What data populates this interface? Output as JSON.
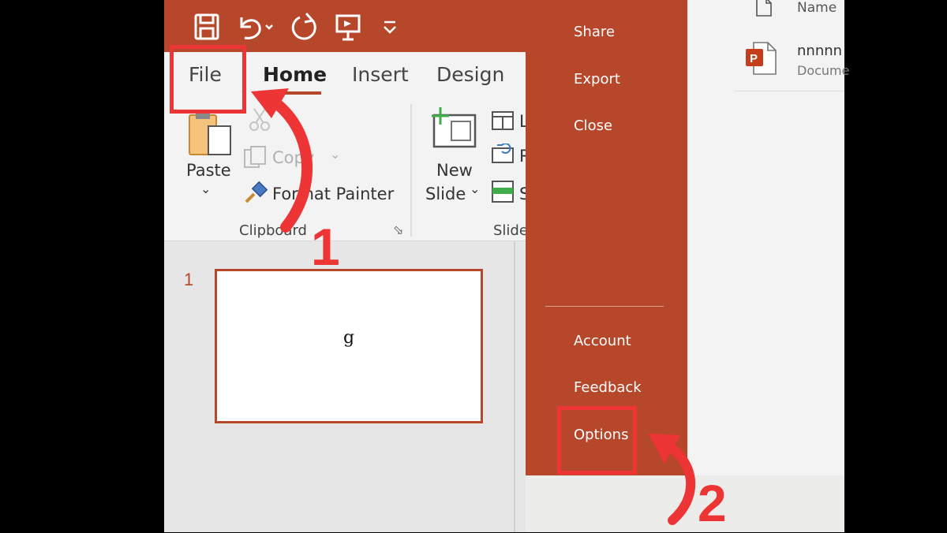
{
  "ribbon_tabs": [
    "File",
    "Home",
    "Insert",
    "Design"
  ],
  "clipboard": {
    "paste_label": "Paste",
    "copy_label": "Copy",
    "format_painter_label": "Format Painter",
    "group_label": "Clipboard"
  },
  "slides": {
    "new_slide_label_1": "New",
    "new_slide_label_2": "Slide",
    "group_label": "Slide",
    "layout_initial": "L",
    "reset_initial": "R",
    "section_initial": "S"
  },
  "thumbnail": {
    "number": "1",
    "text": "g"
  },
  "backstage": {
    "top_items": [
      "Share",
      "Export",
      "Close"
    ],
    "bottom_items": [
      "Account",
      "Feedback",
      "Options"
    ]
  },
  "recent": {
    "column_header": "Name",
    "file_name": "nnnnn",
    "file_type": "Docume"
  },
  "annotations": {
    "step1": "1",
    "step2": "2",
    "color": "#ee3535"
  },
  "colors": {
    "accent": "#b7472a",
    "ribbon_bg": "#f3f3f3"
  }
}
